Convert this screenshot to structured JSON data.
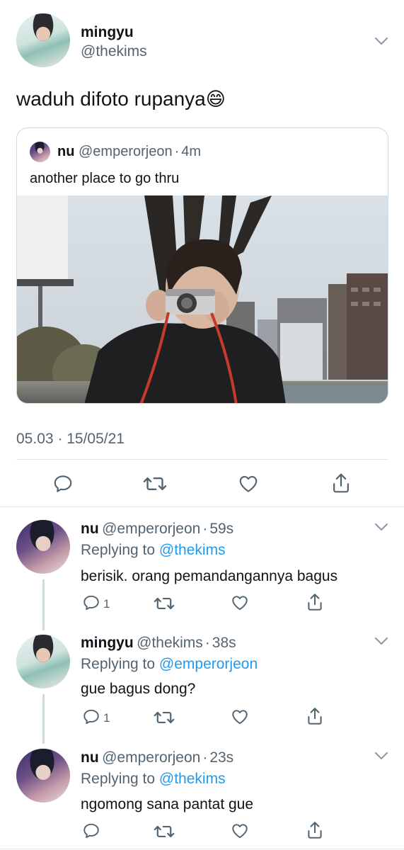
{
  "main_tweet": {
    "author_name": "mingyu",
    "author_handle": "@thekims",
    "text": "waduh difoto rupanya",
    "emoji": "😄",
    "quoted": {
      "author_name": "nu",
      "author_handle": "@emperorjeon",
      "separator": "·",
      "time": "4m",
      "text": "another place to go thru"
    },
    "timestamp": "05.03 · 15/05/21"
  },
  "replies": [
    {
      "author_name": "nu",
      "author_handle": "@emperorjeon",
      "separator": "·",
      "time": "59s",
      "replying_prefix": "Replying to",
      "replying_to": "@thekims",
      "text": "berisik. orang pemandangannya bagus",
      "reply_count": "1"
    },
    {
      "author_name": "mingyu",
      "author_handle": "@thekims",
      "separator": "·",
      "time": "38s",
      "replying_prefix": "Replying to",
      "replying_to": "@emperorjeon",
      "text": "gue bagus dong?",
      "reply_count": "1"
    },
    {
      "author_name": "nu",
      "author_handle": "@emperorjeon",
      "separator": "·",
      "time": "23s",
      "replying_prefix": "Replying to",
      "replying_to": "@thekims",
      "text": "ngomong sana pantat gue",
      "reply_count": ""
    }
  ],
  "icons": {
    "reply": "reply-icon",
    "retweet": "retweet-icon",
    "like": "heart-icon",
    "share": "share-icon",
    "more": "chevron-down-icon"
  },
  "colors": {
    "link": "#1d9bf0",
    "secondary_text": "#536471",
    "icon": "#536471",
    "divider": "#e1e6ea"
  }
}
